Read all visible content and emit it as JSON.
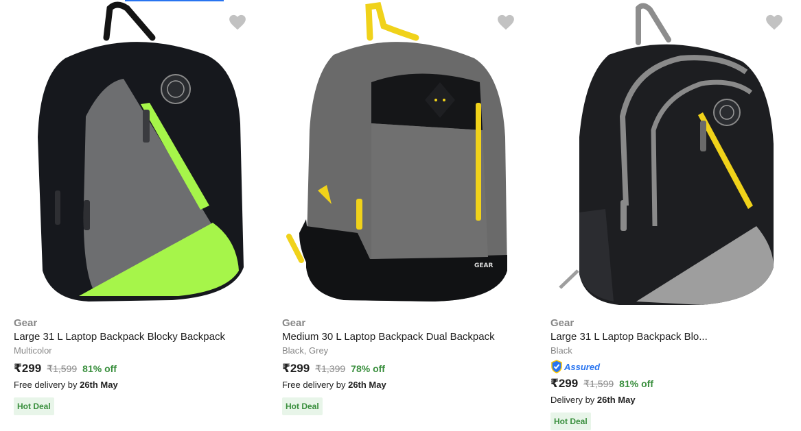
{
  "products": [
    {
      "brand": "Gear",
      "title": "Large 31 L Laptop Backpack Blocky Backpack",
      "variant": "Multicolor",
      "assured": "",
      "price": "₹299",
      "mrp": "₹1,599",
      "discount": "81% off",
      "delivery_prefix": "Free delivery by ",
      "delivery_date": "26th May",
      "badge": "Hot Deal"
    },
    {
      "brand": "Gear",
      "title": "Medium 30 L Laptop Backpack Dual Backpack",
      "variant": "Black, Grey",
      "assured": "",
      "price": "₹299",
      "mrp": "₹1,399",
      "discount": "78% off",
      "delivery_prefix": "Free delivery by ",
      "delivery_date": "26th May",
      "badge": "Hot Deal"
    },
    {
      "brand": "Gear",
      "title": "Large 31 L Laptop Backpack Blo...",
      "variant": "Black",
      "assured": "Assured",
      "price": "₹299",
      "mrp": "₹1,599",
      "discount": "81% off",
      "delivery_prefix": "Delivery by ",
      "delivery_date": "26th May",
      "badge": "Hot Deal"
    }
  ],
  "icons": {
    "wishlist": "heart-icon",
    "assured": "assured-shield-icon"
  },
  "colors": {
    "accent": "#2874f0",
    "discount": "#388e3c",
    "badge_bg": "#e8f5e9",
    "muted": "#878787",
    "heart": "#c2c2c2"
  }
}
